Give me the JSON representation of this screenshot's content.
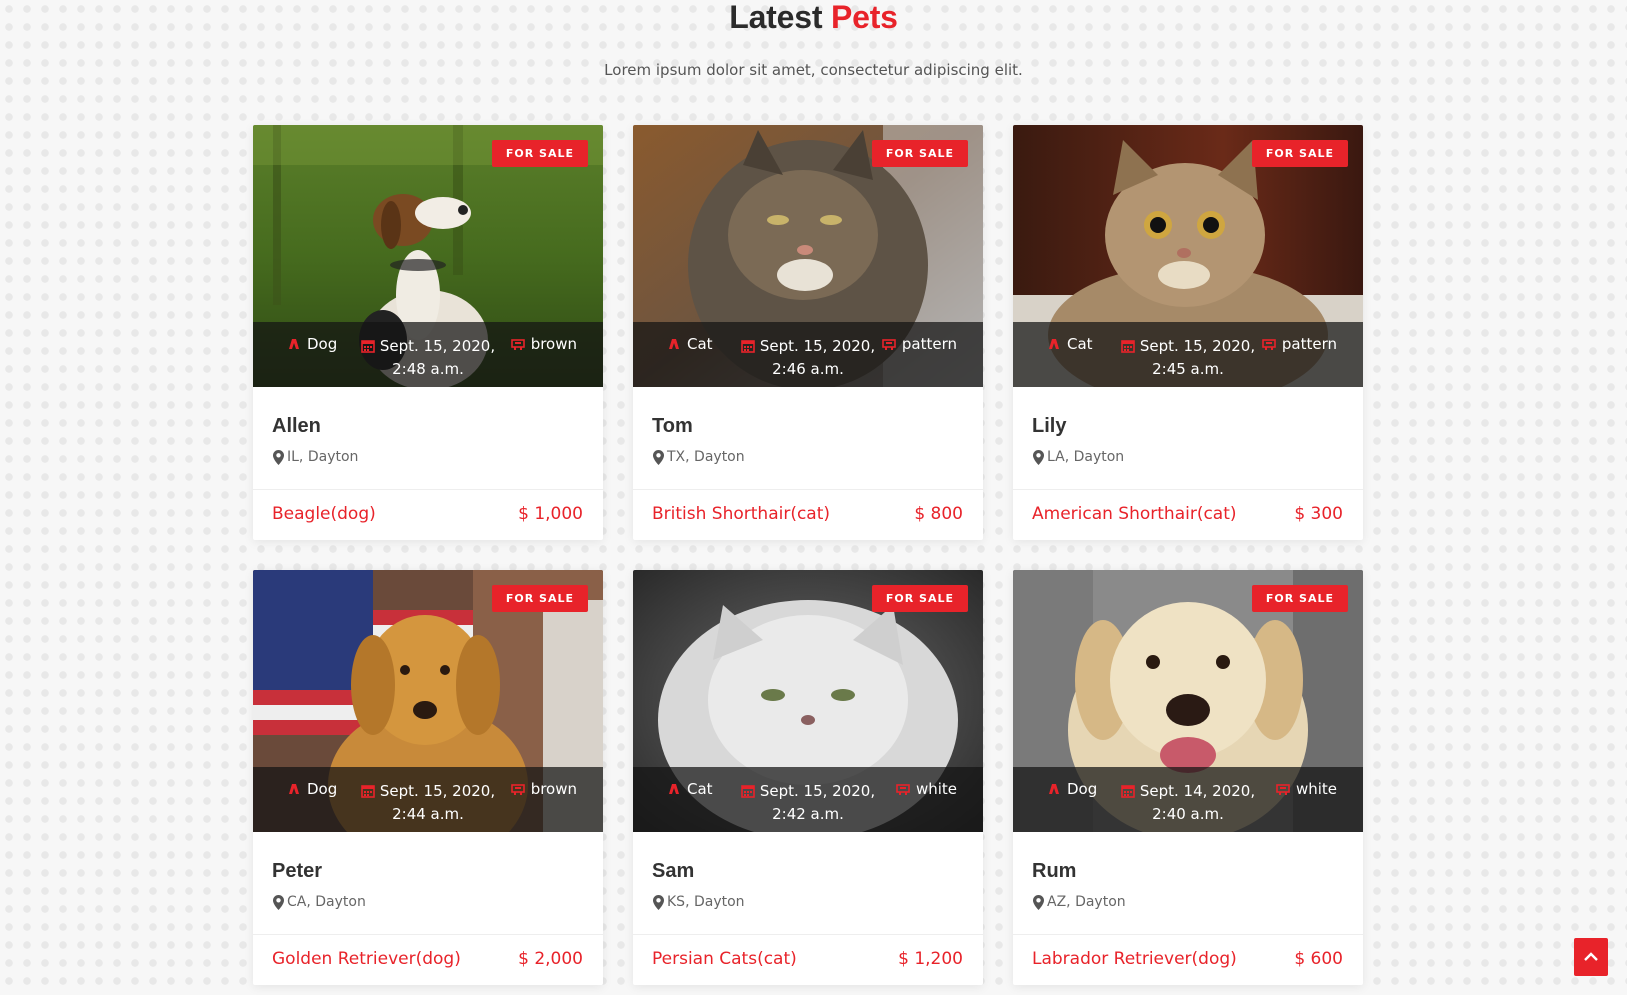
{
  "section": {
    "title_main": "Latest ",
    "title_accent": "Pets",
    "subtitle": "Lorem ipsum dolor sit amet, consectetur adipiscing elit."
  },
  "pets": [
    {
      "badge": "FOR SALE",
      "type": "Dog",
      "date": "Sept. 15, 2020, 2:48 a.m.",
      "color": "brown",
      "name": "Allen",
      "location": "IL, Dayton",
      "breed": "Beagle(dog)",
      "price": "$ 1,000",
      "image": "beagle-dog-photo"
    },
    {
      "badge": "FOR SALE",
      "type": "Cat",
      "date": "Sept. 15, 2020, 2:46 a.m.",
      "color": "pattern",
      "name": "Tom",
      "location": "TX, Dayton",
      "breed": "British Shorthair(cat)",
      "price": "$ 800",
      "image": "tabby-cat-photo"
    },
    {
      "badge": "FOR SALE",
      "type": "Cat",
      "date": "Sept. 15, 2020, 2:45 a.m.",
      "color": "pattern",
      "name": "Lily",
      "location": "LA, Dayton",
      "breed": "American Shorthair(cat)",
      "price": "$ 300",
      "image": "shorthair-cat-photo"
    },
    {
      "badge": "FOR SALE",
      "type": "Dog",
      "date": "Sept. 15, 2020, 2:44 a.m.",
      "color": "brown",
      "name": "Peter",
      "location": "CA, Dayton",
      "breed": "Golden Retriever(dog)",
      "price": "$ 2,000",
      "image": "golden-retriever-photo"
    },
    {
      "badge": "FOR SALE",
      "type": "Cat",
      "date": "Sept. 15, 2020, 2:42 a.m.",
      "color": "white",
      "name": "Sam",
      "location": "KS, Dayton",
      "breed": "Persian Cats(cat)",
      "price": "$ 1,200",
      "image": "persian-cat-photo"
    },
    {
      "badge": "FOR SALE",
      "type": "Dog",
      "date": "Sept. 14, 2020, 2:40 a.m.",
      "color": "white",
      "name": "Rum",
      "location": "AZ, Dayton",
      "breed": "Labrador Retriever(dog)",
      "price": "$ 600",
      "image": "labrador-dog-photo"
    }
  ],
  "colors": {
    "accent": "#e8232a",
    "background": "#f7f7f7"
  },
  "icons": {
    "type": "paw-icon",
    "date": "calendar-icon",
    "color": "palette-icon",
    "location": "map-marker-icon",
    "scroll": "chevron-up-icon"
  }
}
